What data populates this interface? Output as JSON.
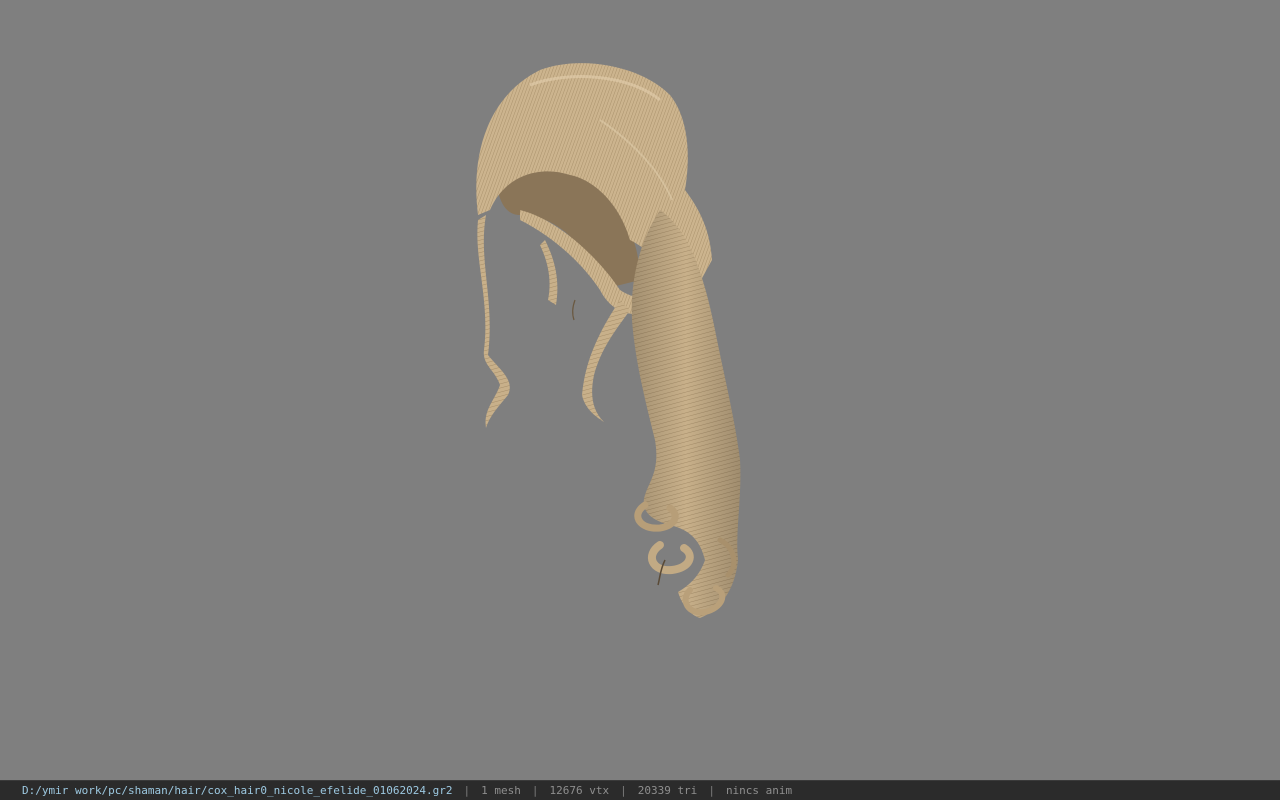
{
  "viewport": {
    "background_color": "#7f7f7f",
    "model_name": "hair-mesh",
    "hair_color": "#c8b08a",
    "hair_shadow_color": "#8a7558",
    "hair_highlight_color": "#e2cfae"
  },
  "status_bar": {
    "file_path": "D:/ymir work/pc/shaman/hair/cox_hair0_nicole_efelide_01062024.gr2",
    "separator": "|",
    "mesh_count": "1 mesh",
    "vertex_count": "12676 vtx",
    "triangle_count": "20339 tri",
    "animation_status": "nincs anim",
    "path_color": "#9cc8e0",
    "text_color": "#8e8e8e",
    "background_color": "#2b2b2b"
  }
}
